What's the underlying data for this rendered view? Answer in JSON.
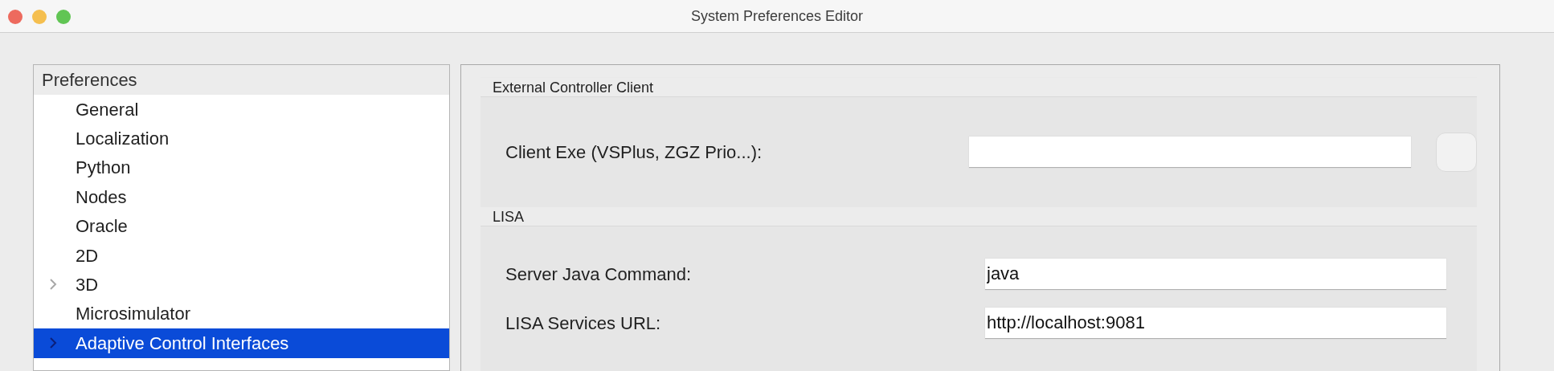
{
  "window": {
    "title": "System Preferences Editor"
  },
  "sidebar": {
    "header": "Preferences",
    "items": [
      {
        "label": "General",
        "expandable": false,
        "selected": false
      },
      {
        "label": "Localization",
        "expandable": false,
        "selected": false
      },
      {
        "label": "Python",
        "expandable": false,
        "selected": false
      },
      {
        "label": "Nodes",
        "expandable": false,
        "selected": false
      },
      {
        "label": "Oracle",
        "expandable": false,
        "selected": false
      },
      {
        "label": "2D",
        "expandable": false,
        "selected": false
      },
      {
        "label": "3D",
        "expandable": true,
        "selected": false
      },
      {
        "label": "Microsimulator",
        "expandable": false,
        "selected": false
      },
      {
        "label": "Adaptive Control Interfaces",
        "expandable": true,
        "selected": true
      }
    ]
  },
  "groups": [
    {
      "title": "External Controller Client",
      "fields": [
        {
          "label": "Client Exe (VSPlus, ZGZ Prio...):",
          "has_button": true
        }
      ]
    },
    {
      "title": "LISA",
      "fields": [
        {
          "label": "Server Java Command:",
          "value": "java",
          "has_button": false
        },
        {
          "label": "LISA Services URL:",
          "value": "http://localhost:9081",
          "has_button": false
        }
      ]
    }
  ]
}
